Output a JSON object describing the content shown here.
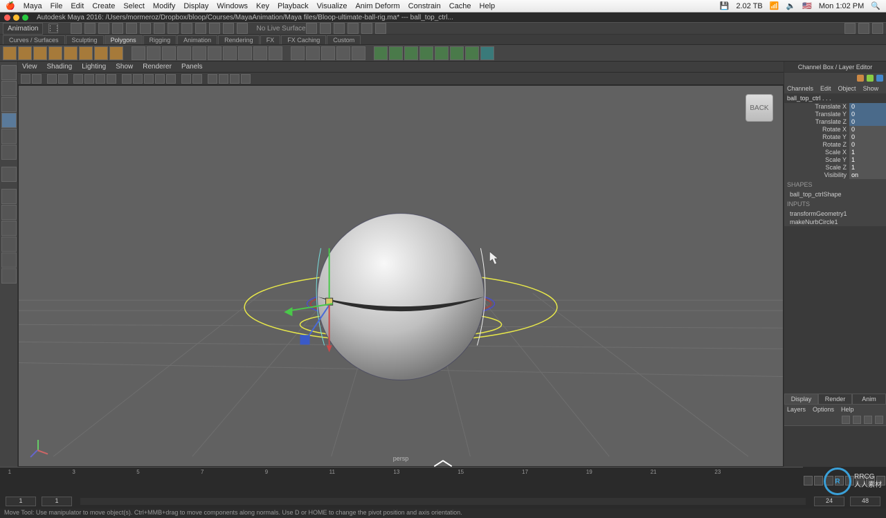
{
  "mac_menu": {
    "app": "Maya",
    "items": [
      "File",
      "Edit",
      "Create",
      "Select",
      "Modify",
      "Display",
      "Windows",
      "Key",
      "Playback",
      "Visualize",
      "Anim Deform",
      "Constrain",
      "Cache",
      "Help"
    ],
    "right": {
      "storage": "2.02 TB",
      "battery": "",
      "wifi": "",
      "sound": "",
      "flag": "",
      "clock": "Mon 1:02 PM",
      "search": ""
    }
  },
  "titlebar": {
    "path": "Autodesk Maya 2016: /Users/mormeroz/Dropbox/bloop/Courses/MayaAnimation/Maya files/Bloop-ultimate-ball-rig.ma*  ---  ball_top_ctrl..."
  },
  "workspace": {
    "mode": "Animation",
    "live_surface": "No Live Surface"
  },
  "shelf_tabs": [
    "Curves / Surfaces",
    "Sculpting",
    "Polygons",
    "Rigging",
    "Animation",
    "Rendering",
    "FX",
    "FX Caching",
    "Custom"
  ],
  "active_shelf": 2,
  "panel_menu": [
    "View",
    "Shading",
    "Lighting",
    "Show",
    "Renderer",
    "Panels"
  ],
  "viewcube": "BACK",
  "viewport_label": "persp",
  "channelbox": {
    "title": "Channel Box / Layer Editor",
    "menu": [
      "Channels",
      "Edit",
      "Object",
      "Show"
    ],
    "object": "ball_top_ctrl . . .",
    "attrs": [
      {
        "name": "Translate X",
        "val": "0",
        "hl": true
      },
      {
        "name": "Translate Y",
        "val": "0",
        "hl": true
      },
      {
        "name": "Translate Z",
        "val": "0",
        "hl": true
      },
      {
        "name": "Rotate X",
        "val": "0",
        "hl": false
      },
      {
        "name": "Rotate Y",
        "val": "0",
        "hl": false
      },
      {
        "name": "Rotate Z",
        "val": "0",
        "hl": false
      },
      {
        "name": "Scale X",
        "val": "1",
        "hl": false
      },
      {
        "name": "Scale Y",
        "val": "1",
        "hl": false
      },
      {
        "name": "Scale Z",
        "val": "1",
        "hl": false
      },
      {
        "name": "Visibility",
        "val": "on",
        "hl": false
      }
    ],
    "shapes_label": "SHAPES",
    "shape": "ball_top_ctrlShape",
    "inputs_label": "INPUTS",
    "inputs": [
      "transformGeometry1",
      "makeNurbCircle1"
    ],
    "layer_tabs": [
      "Display",
      "Render",
      "Anim"
    ],
    "layer_menu": [
      "Layers",
      "Options",
      "Help"
    ]
  },
  "timeline": {
    "ticks": [
      "1",
      "3",
      "5",
      "7",
      "9",
      "11",
      "13",
      "15",
      "17",
      "19",
      "21",
      "23"
    ],
    "range_start": "1",
    "range_end_inner": "24",
    "range_end": "48"
  },
  "status": "Move Tool: Use manipulator to move object(s). Ctrl+MMB+drag to move components along normals. Use D or HOME to change the pivot position and axis orientation.",
  "watermark": "人人素材",
  "rrcg": "RRCG"
}
